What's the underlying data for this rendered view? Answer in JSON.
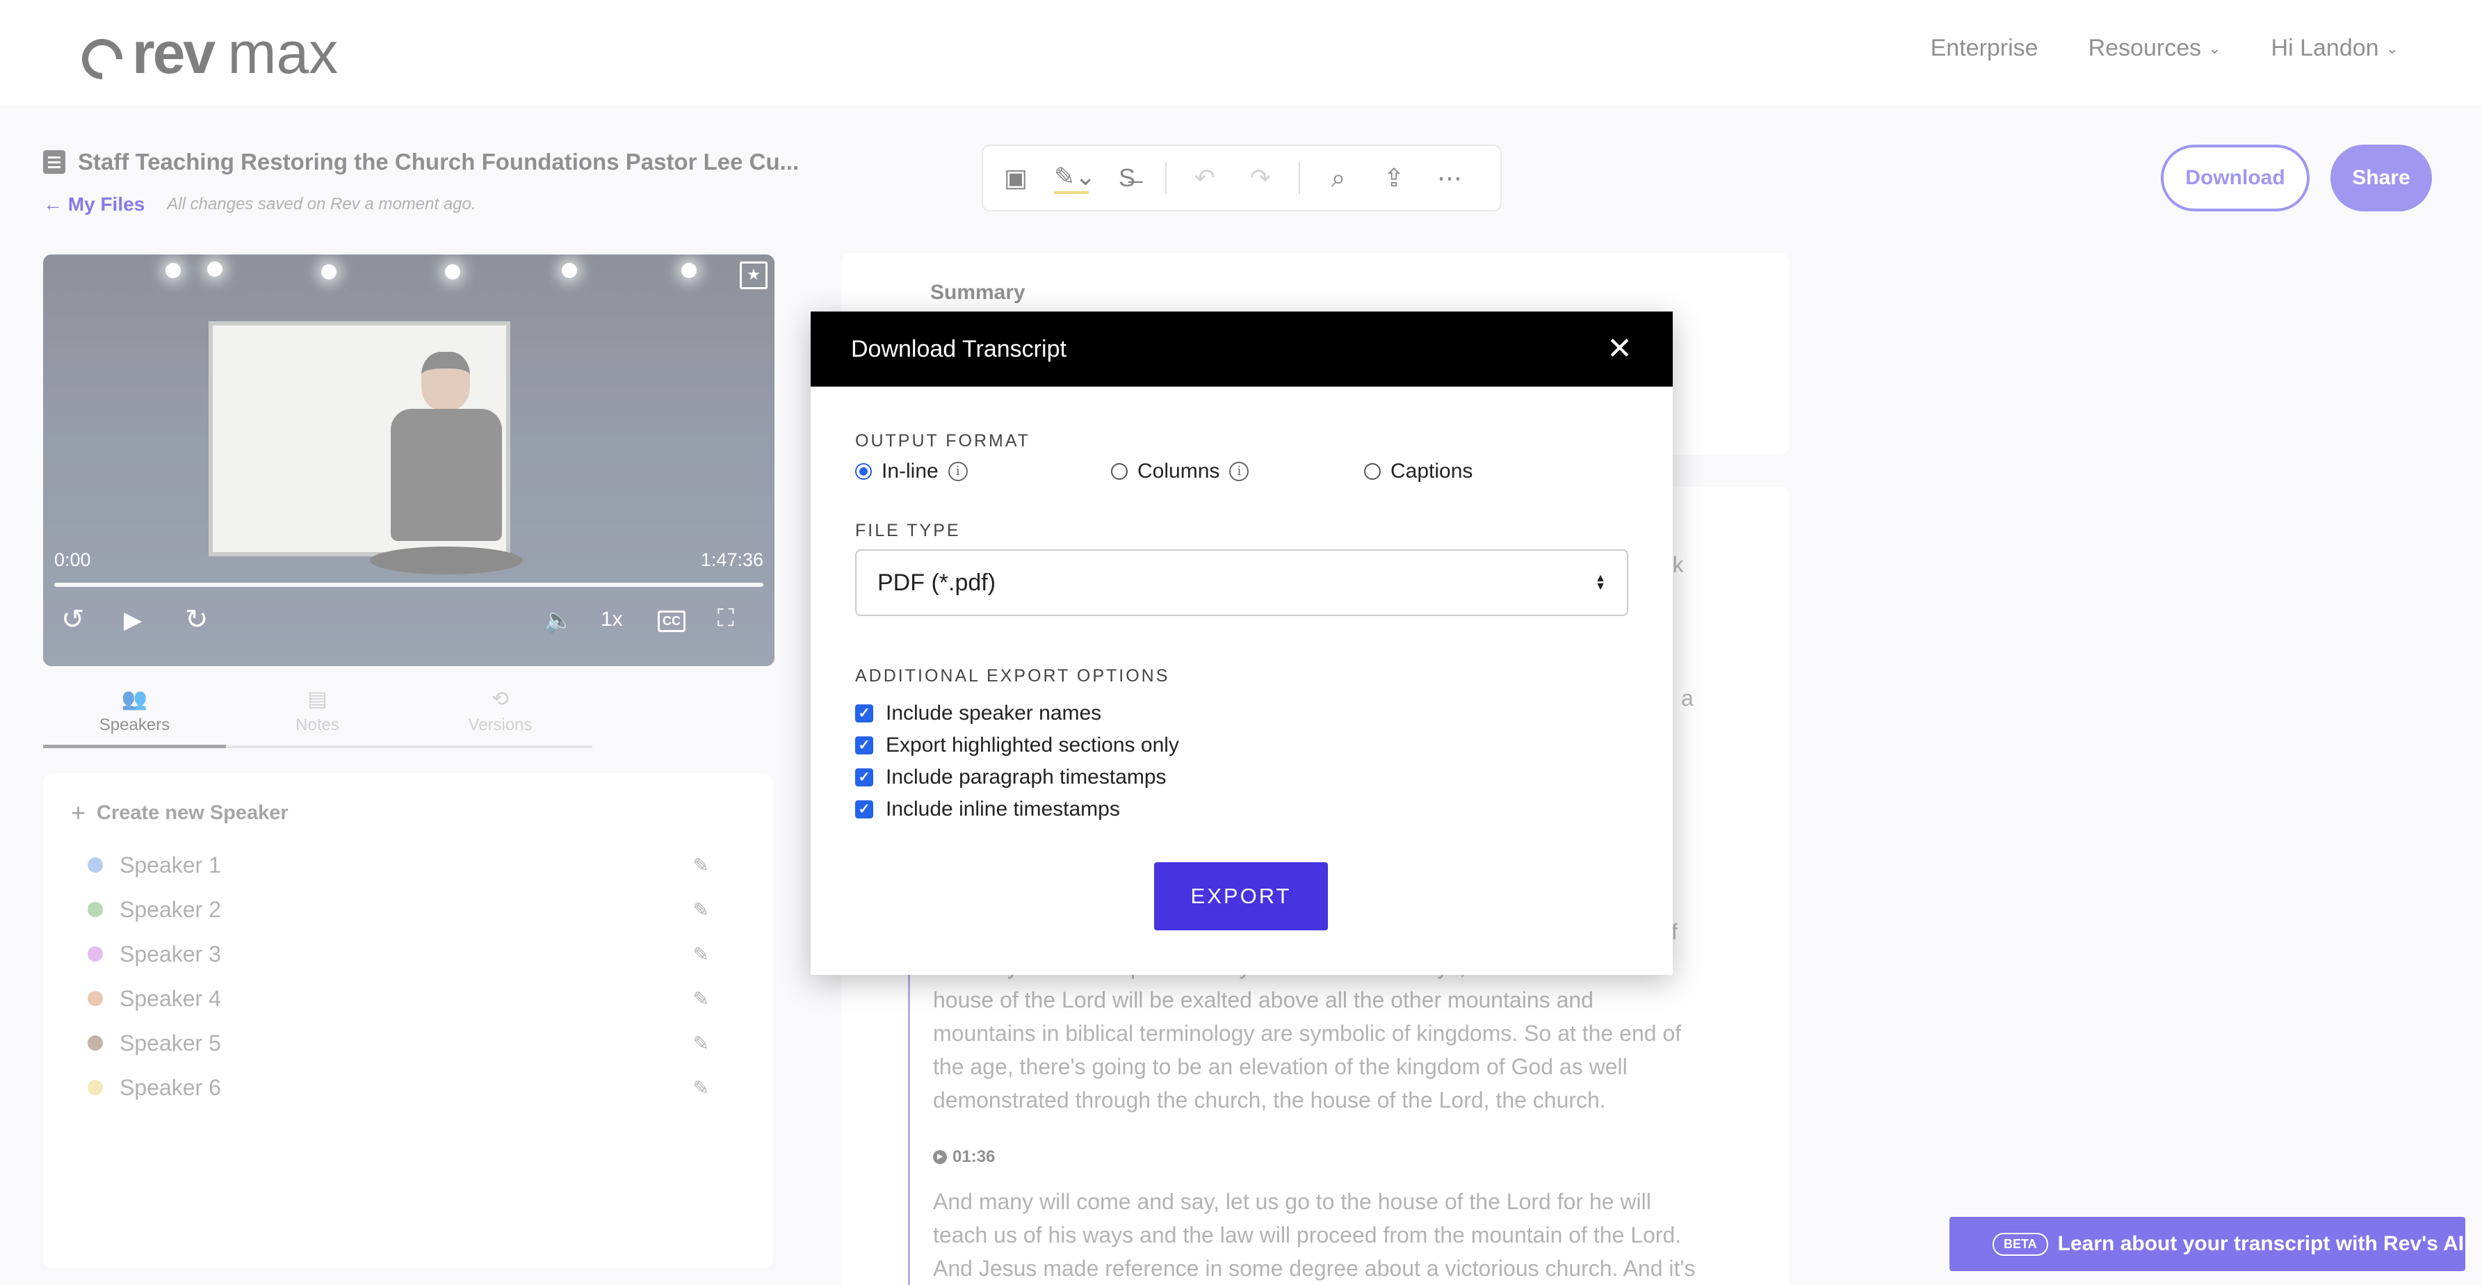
{
  "header": {
    "logo_bold": "rev",
    "logo_light": "max",
    "nav": [
      {
        "label": "Enterprise"
      },
      {
        "label": "Resources"
      },
      {
        "label": "Hi Landon"
      }
    ]
  },
  "document": {
    "title": "Staff Teaching Restoring the Church Foundations Pastor Lee Cu...",
    "back_label": "My Files",
    "saved_status": "All changes saved on Rev a moment ago."
  },
  "actions": {
    "download": "Download",
    "share": "Share"
  },
  "player": {
    "current_time": "0:00",
    "duration": "1:47:36",
    "speed": "1x",
    "cc": "CC"
  },
  "tabs": [
    {
      "label": "Speakers",
      "active": true
    },
    {
      "label": "Notes",
      "active": false
    },
    {
      "label": "Versions",
      "active": false
    }
  ],
  "speakers_panel": {
    "create_label": "Create new Speaker",
    "speakers": [
      {
        "name": "Speaker 1",
        "color": "#8fb1e8"
      },
      {
        "name": "Speaker 2",
        "color": "#93c48f"
      },
      {
        "name": "Speaker 3",
        "color": "#d59ae6"
      },
      {
        "name": "Speaker 4",
        "color": "#e0a98c"
      },
      {
        "name": "Speaker 5",
        "color": "#a88b7a"
      },
      {
        "name": "Speaker 6",
        "color": "#f0dd95"
      }
    ]
  },
  "transcript": {
    "summary_title": "Summary",
    "fragments": [
      "eek",
      "a",
      "f"
    ],
    "paragraph_1_lines": [
      "the story. Isaiah chapter two says that in the last days, the mountain of the",
      "house of the Lord will be exalted above all the other mountains and",
      "mountains in biblical terminology are symbolic of kingdoms. So at the end of",
      "the age, there's going to be an elevation of the kingdom of God as well",
      "demonstrated through the church, the house of the Lord, the church."
    ],
    "timestamp": "01:36",
    "paragraph_2_lines": [
      "And many will come and say, let us go to the house of the Lord for he will",
      "teach us of his ways and the law will proceed from the mountain of the Lord.",
      "And Jesus made reference in some degree about a victorious church. And it's"
    ]
  },
  "ai_banner": {
    "badge": "BETA",
    "text": "Learn about your transcript with Rev's AI"
  },
  "modal": {
    "title": "Download Transcript",
    "output_format_label": "OUTPUT FORMAT",
    "formats": [
      {
        "label": "In-line",
        "checked": true,
        "info": true
      },
      {
        "label": "Columns",
        "checked": false,
        "info": true
      },
      {
        "label": "Captions",
        "checked": false,
        "info": false
      }
    ],
    "file_type_label": "FILE TYPE",
    "file_type_value": "PDF (*.pdf)",
    "export_options_label": "ADDITIONAL EXPORT OPTIONS",
    "options": [
      {
        "label": "Include speaker names",
        "checked": true
      },
      {
        "label": "Export highlighted sections only",
        "checked": true
      },
      {
        "label": "Include paragraph timestamps",
        "checked": true
      },
      {
        "label": "Include inline timestamps",
        "checked": true
      }
    ],
    "export_button": "EXPORT"
  },
  "colors": {
    "brand_purple": "#6e60e8",
    "export_button": "#4733e0",
    "checkbox_blue": "#2563eb",
    "ai_banner": "#3c2be0"
  }
}
